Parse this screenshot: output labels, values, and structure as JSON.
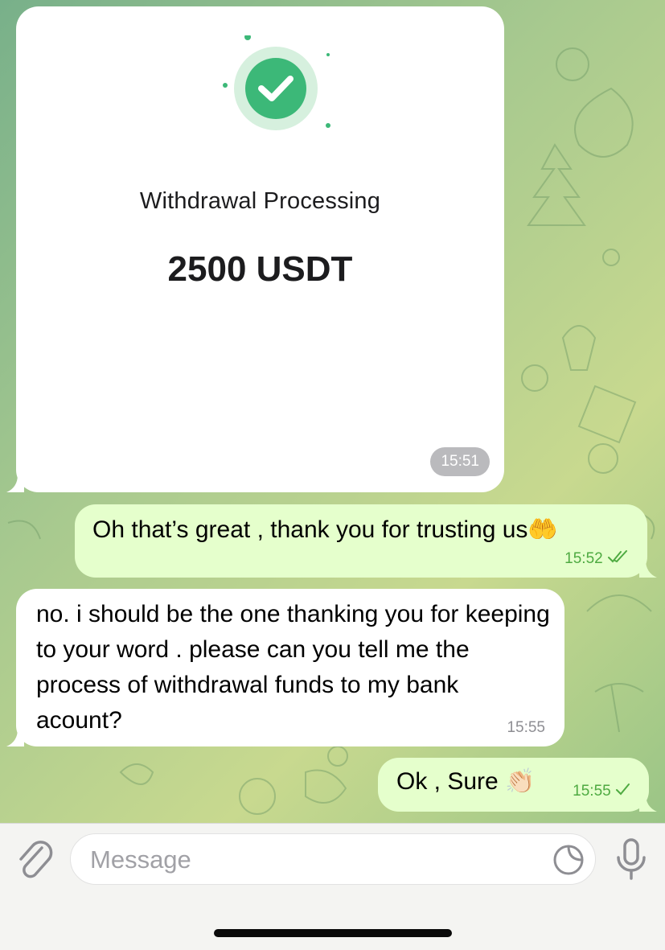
{
  "chat": {
    "messages": [
      {
        "type": "image",
        "direction": "incoming",
        "image_title": "Withdrawal Processing",
        "image_amount": "2500 USDT",
        "time": "15:51"
      },
      {
        "type": "text",
        "direction": "outgoing",
        "text": "Oh that’s great , thank you for trusting us",
        "emoji": "🤲",
        "time": "15:52",
        "status": "read"
      },
      {
        "type": "text",
        "direction": "incoming",
        "text": "no. i should be the one thanking you for keeping to your word . please can you tell me the process of withdrawal funds to my bank acount?",
        "time": "15:55"
      },
      {
        "type": "text",
        "direction": "outgoing",
        "text": "Ok , Sure",
        "emoji": "👏🏻",
        "time": "15:55",
        "status": "delivered"
      }
    ]
  },
  "composer": {
    "placeholder": "Message",
    "icons": [
      "paperclip-icon",
      "sticker-icon",
      "microphone-icon"
    ]
  },
  "colors": {
    "incoming_bubble": "#ffffff",
    "outgoing_bubble": "#e5ffcc",
    "outgoing_time": "#4eaa41",
    "success_green": "#3cb878"
  }
}
